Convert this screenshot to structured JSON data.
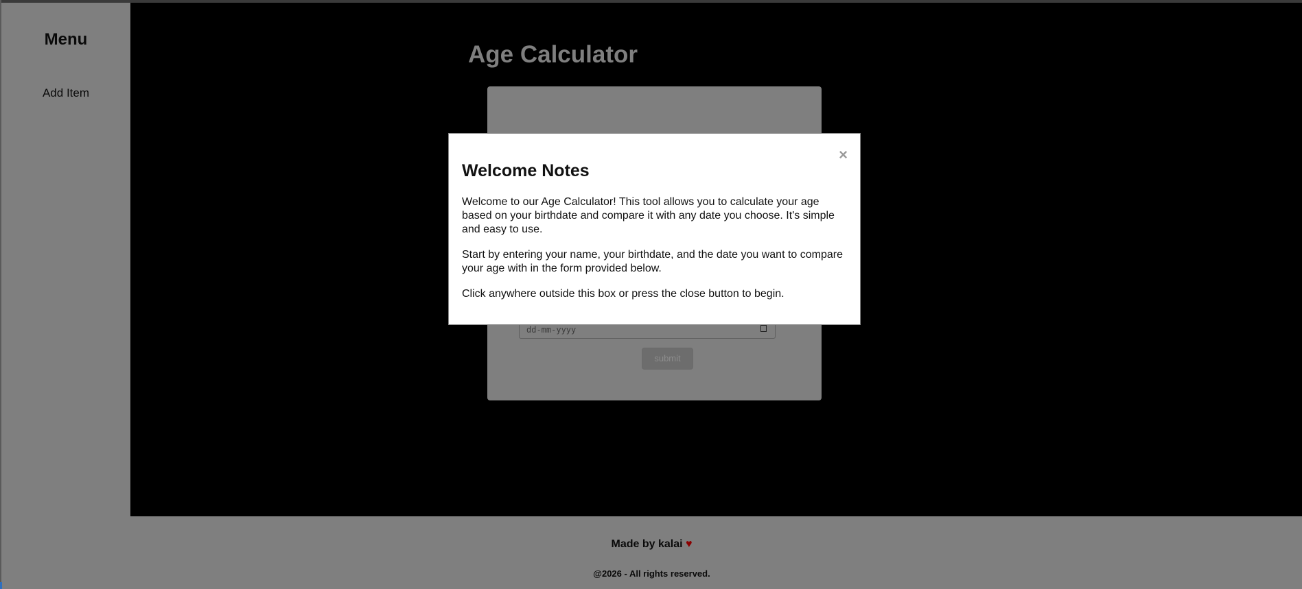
{
  "sidebar": {
    "title": "Menu",
    "items": [
      {
        "label": "Add Item"
      }
    ]
  },
  "main": {
    "title": "Age Calculator",
    "form": {
      "date_placeholder": "dd-mm-yyyy",
      "submit_label": "submit"
    }
  },
  "modal": {
    "title": "Welcome Notes",
    "close_symbol": "×",
    "paragraphs": [
      "Welcome to our Age Calculator! This tool allows you to calculate your age based on your birthdate and compare it with any date you choose. It's simple and easy to use.",
      "Start by entering your name, your birthdate, and the date you want to compare your age with in the form provided below.",
      "Click anywhere outside this box or press the close button to begin."
    ]
  },
  "footer": {
    "made_by": "Made by kalai",
    "heart_symbol": "♥",
    "rights": "@2026 - All rights reserved."
  }
}
